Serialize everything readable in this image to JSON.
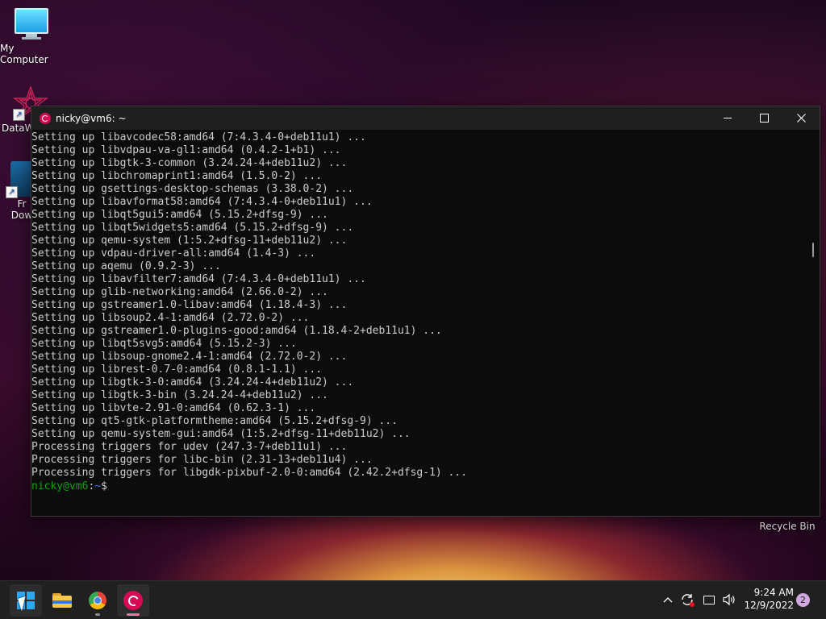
{
  "desktop": {
    "icons": [
      {
        "label": "My Computer"
      },
      {
        "label": "DataW"
      },
      {
        "label": "Fr"
      },
      {
        "label": "Dow"
      }
    ],
    "recycle_bin": "Recycle Bin"
  },
  "terminal": {
    "title": "nicky@vm6: ~",
    "lines": [
      "Setting up libavcodec58:amd64 (7:4.3.4-0+deb11u1) ...",
      "Setting up libvdpau-va-gl1:amd64 (0.4.2-1+b1) ...",
      "Setting up libgtk-3-common (3.24.24-4+deb11u2) ...",
      "Setting up libchromaprint1:amd64 (1.5.0-2) ...",
      "Setting up gsettings-desktop-schemas (3.38.0-2) ...",
      "Setting up libavformat58:amd64 (7:4.3.4-0+deb11u1) ...",
      "Setting up libqt5gui5:amd64 (5.15.2+dfsg-9) ...",
      "Setting up libqt5widgets5:amd64 (5.15.2+dfsg-9) ...",
      "Setting up qemu-system (1:5.2+dfsg-11+deb11u2) ...",
      "Setting up vdpau-driver-all:amd64 (1.4-3) ...",
      "Setting up aqemu (0.9.2-3) ...",
      "Setting up libavfilter7:amd64 (7:4.3.4-0+deb11u1) ...",
      "Setting up glib-networking:amd64 (2.66.0-2) ...",
      "Setting up gstreamer1.0-libav:amd64 (1.18.4-3) ...",
      "Setting up libsoup2.4-1:amd64 (2.72.0-2) ...",
      "Setting up gstreamer1.0-plugins-good:amd64 (1.18.4-2+deb11u1) ...",
      "Setting up libqt5svg5:amd64 (5.15.2-3) ...",
      "Setting up libsoup-gnome2.4-1:amd64 (2.72.0-2) ...",
      "Setting up librest-0.7-0:amd64 (0.8.1-1.1) ...",
      "Setting up libgtk-3-0:amd64 (3.24.24-4+deb11u2) ...",
      "Setting up libgtk-3-bin (3.24.24-4+deb11u2) ...",
      "Setting up libvte-2.91-0:amd64 (0.62.3-1) ...",
      "Setting up qt5-gtk-platformtheme:amd64 (5.15.2+dfsg-9) ...",
      "Setting up qemu-system-gui:amd64 (1:5.2+dfsg-11+deb11u2) ...",
      "Processing triggers for udev (247.3-7+deb11u1) ...",
      "Processing triggers for libc-bin (2.31-13+deb11u4) ...",
      "Processing triggers for libgdk-pixbuf-2.0-0:amd64 (2.42.2+dfsg-1) ..."
    ],
    "prompt": {
      "user_host": "nicky@vm6",
      "separator": ":",
      "path": "~",
      "symbol": "$"
    }
  },
  "taskbar": {
    "apps": [
      {
        "name": "start",
        "icon": "windows-logo-icon"
      },
      {
        "name": "file-explorer",
        "icon": "folder-icon"
      },
      {
        "name": "chrome",
        "icon": "chrome-icon"
      },
      {
        "name": "debian-terminal",
        "icon": "debian-icon"
      }
    ],
    "tray": {
      "time": "9:24 AM",
      "date": "12/9/2022",
      "notifications": "2"
    }
  },
  "colors": {
    "terminal_bg": "#0c0c0c",
    "terminal_text": "#cccccc",
    "prompt_user": "#13a10e",
    "prompt_path": "#3b78ff",
    "titlebar_bg": "#1f1f1f",
    "taskbar_bg": "#202020",
    "debian_red": "#d70a53",
    "windows_blue": "#2aa7f5"
  }
}
